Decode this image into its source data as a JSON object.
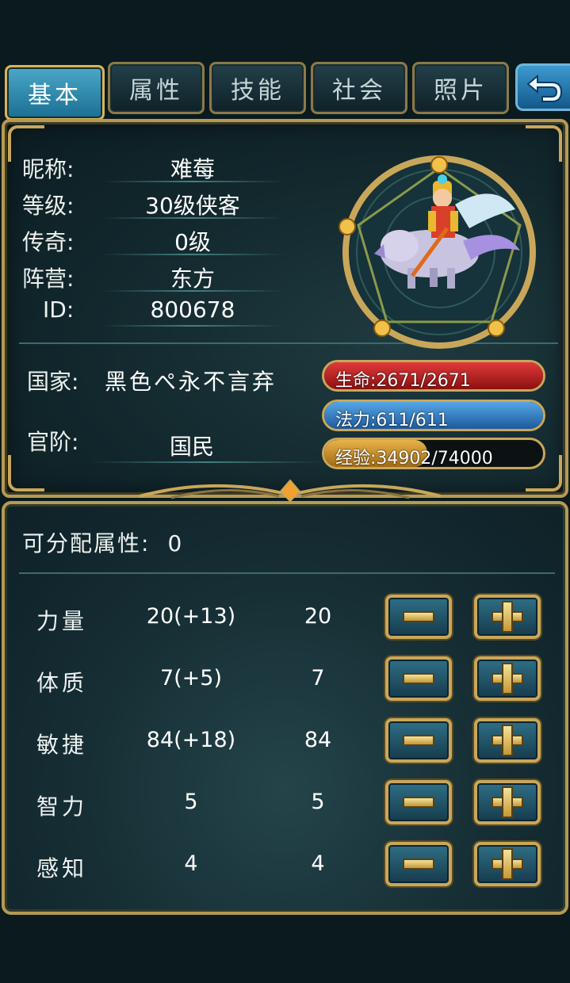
{
  "tabs": [
    {
      "label": "基本",
      "active": true
    },
    {
      "label": "属性",
      "active": false
    },
    {
      "label": "技能",
      "active": false
    },
    {
      "label": "社会",
      "active": false
    },
    {
      "label": "照片",
      "active": false
    }
  ],
  "back_icon": "return-arrow-icon",
  "profile": {
    "nickname_label": "昵称:",
    "nickname": "难莓",
    "level_label": "等级:",
    "level": "30级侠客",
    "legend_label": "传奇:",
    "legend": "0级",
    "camp_label": "阵营:",
    "camp": "东方",
    "id_label": "ID:",
    "id": "800678",
    "country_label": "国家:",
    "country": "黑色ぺ永不言弃",
    "rank_label": "官阶:",
    "rank": "国民"
  },
  "bars": {
    "hp": {
      "text": "生命:2671/2671",
      "fraction": 1.0,
      "color": "#c62222"
    },
    "mp": {
      "text": "法力:611/611",
      "fraction": 1.0,
      "color": "#2f7fc6"
    },
    "xp": {
      "text": "经验:34902/74000",
      "fraction": 0.4717,
      "color": "#d49a2a"
    }
  },
  "attributes": {
    "free_label": "可分配属性:",
    "free_points": "0",
    "rows": [
      {
        "name": "力量",
        "base": "20(+13)",
        "total": "20"
      },
      {
        "name": "体质",
        "base": "7(+5)",
        "total": "7"
      },
      {
        "name": "敏捷",
        "base": "84(+18)",
        "total": "84"
      },
      {
        "name": "智力",
        "base": "5",
        "total": "5"
      },
      {
        "name": "感知",
        "base": "4",
        "total": "4"
      }
    ]
  },
  "colors": {
    "frame_gold": "#c9a75a",
    "active_tab": "#3a9bc0",
    "panel_bg": "#12282d"
  }
}
